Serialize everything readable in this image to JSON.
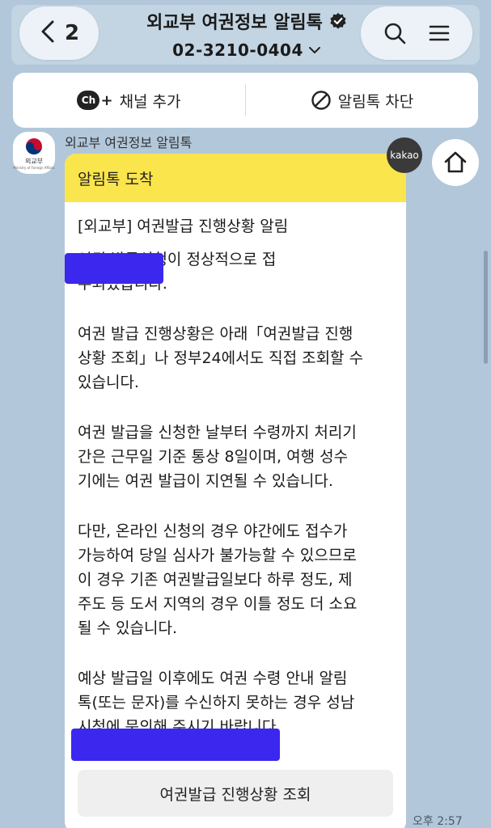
{
  "header": {
    "back_count": "2",
    "title": "외교부 여권정보 알림톡",
    "phone": "02-3210-0404"
  },
  "action_bar": {
    "add_channel_label": "채널 추가",
    "add_channel_icon_text": "Ch",
    "block_label": "알림톡 차단"
  },
  "sender": {
    "name": "외교부 여권정보 알림톡",
    "avatar_text": "외교부",
    "avatar_subtext": "Ministry of Foreign Affairs"
  },
  "message": {
    "header": "알림톡 도착",
    "title": "[외교부] 여권발급 진행상황 알림",
    "paragraphs": [
      "              여권 발급신청이 정상적으로 접\n수되었습니다.",
      "여권 발급 진행상황은 아래「여권발급 진행\n상황 조회」나 정부24에서도 직접 조회할 수\n 있습니다.",
      "여권 발급을 신청한 날부터 수령까지 처리기\n간은 근무일 기준 통상 8일이며, 여행 성수\n기에는 여권 발급이 지연될 수 있습니다.",
      "다만, 온라인 신청의 경우 야간에도 접수가\n가능하여 당일 심사가 불가능할 수 있으므로\n 이 경우 기존 여권발급일보다 하루 정도, 제\n주도 등 도서 지역의 경우 이틀 정도 더 소요\n될 수 있습니다.",
      "예상 발급일 이후에도 여권 수령 안내 알림\n톡(또는 문자)를 수신하지 못하는 경우 성남\n시청에 문의해 주시기 바랍니다."
    ],
    "button_label": "여권발급 진행상황 조회",
    "kakao_badge": "kakao",
    "timestamp": "오후 2:57"
  },
  "colors": {
    "background": "#b2c7da",
    "card_header": "#fae54d",
    "redaction": "#3b27ee"
  }
}
